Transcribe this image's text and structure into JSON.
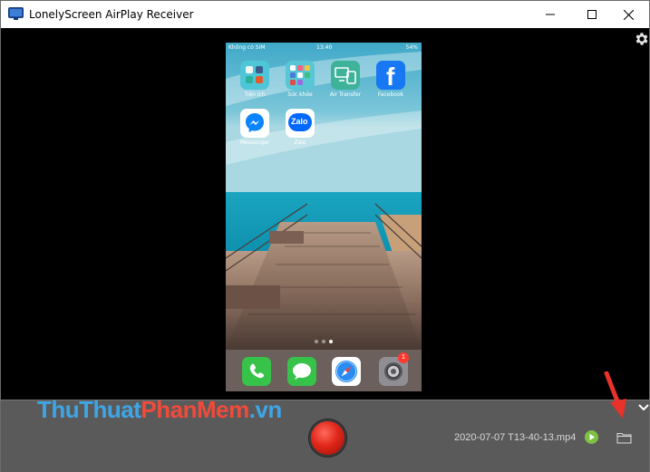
{
  "window": {
    "title": "LonelyScreen AirPlay Receiver",
    "controls": [
      "minimize-icon",
      "maximize-icon",
      "close-icon"
    ]
  },
  "phone": {
    "statusbar": {
      "carrier": "Không có SIM",
      "time": "13:40",
      "battery": "54%"
    },
    "apps": [
      {
        "label": "Tiện ích",
        "icon": "utilities-folder-icon"
      },
      {
        "label": "Sức khỏe",
        "icon": "health-folder-icon"
      },
      {
        "label": "Air Transfer",
        "icon": "air-transfer-icon"
      },
      {
        "label": "Facebook",
        "icon": "facebook-icon"
      },
      {
        "label": "Messenger",
        "icon": "messenger-icon"
      },
      {
        "label": "Zalo",
        "icon": "zalo-icon"
      }
    ],
    "zalo_logo_text": "Zalo",
    "facebook_glyph": "f",
    "page_dots": 3,
    "active_page": 3,
    "dock": [
      {
        "icon": "phone-icon"
      },
      {
        "icon": "messages-icon"
      },
      {
        "icon": "safari-icon"
      },
      {
        "icon": "settings-app-icon",
        "badge": "1"
      }
    ]
  },
  "watermark": {
    "part1": "ThuThuat",
    "part2": "PhanMem",
    "part3": ".vn"
  },
  "controls": {
    "record_icon": "record-icon",
    "filename": "2020-07-07 T13-40-13.mp4",
    "play_icon": "play-icon",
    "folder_icon": "folder-icon",
    "settings_icon": "gear-icon",
    "collapse_icon": "chevron-down-icon"
  },
  "colors": {
    "record": "#e0271a",
    "play": "#7cc142",
    "annotation_arrow": "#e8322a",
    "watermark_blue": "#3ea6e6",
    "watermark_red": "#f04b3a"
  }
}
